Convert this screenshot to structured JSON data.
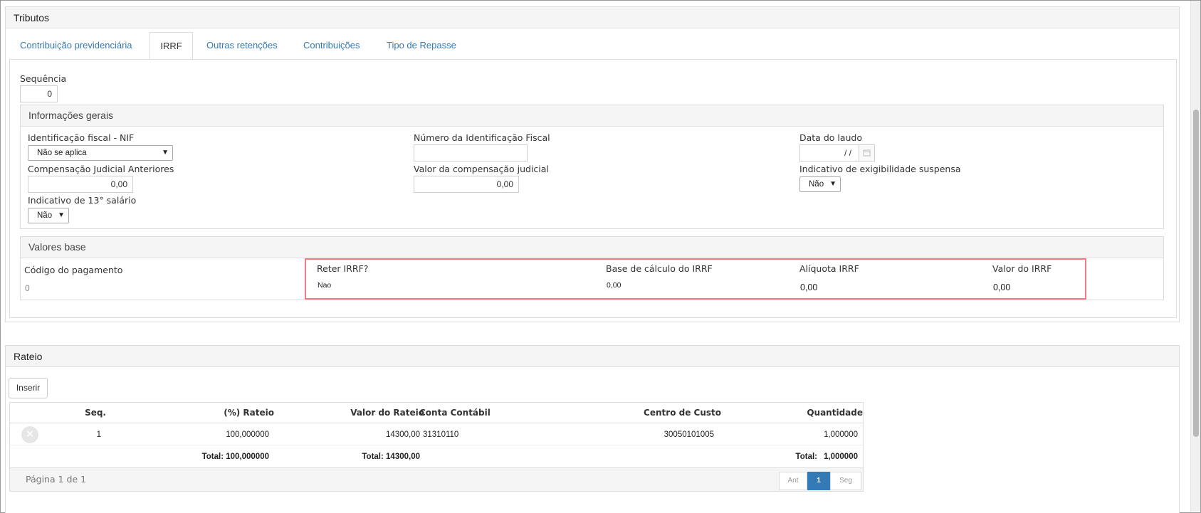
{
  "tributos": {
    "title": "Tributos",
    "tabs": [
      "Contribuição previdenciária",
      "IRRF",
      "Outras retenções",
      "Contribuições",
      "Tipo de Repasse"
    ],
    "active_tab": "IRRF",
    "sequencia": {
      "label": "Sequência",
      "value": "0"
    },
    "informacoes_gerais": {
      "title": "Informações gerais",
      "nif_label": "Identificação fiscal - NIF",
      "nif_value": "Não se aplica",
      "numero_nif_label": "Número da Identificação Fiscal",
      "numero_nif_value": "",
      "data_laudo_label": "Data do laudo",
      "data_laudo_value": "/ /",
      "compensacao_label": "Compensação Judicial Anteriores",
      "compensacao_value": "0,00",
      "valor_compensacao_label": "Valor da compensação judicial",
      "valor_compensacao_value": "0,00",
      "exigibilidade_label": "Indicativo de exigibilidade suspensa",
      "exigibilidade_value": "Não",
      "decimo_label": "Indicativo de 13° salário",
      "decimo_value": "Não"
    },
    "valores_base": {
      "title": "Valores base",
      "codigo_label": "Código do pagamento",
      "codigo_value": "0",
      "reter_label": "Reter IRRF?",
      "reter_value": "Nao",
      "base_label": "Base de cálculo do IRRF",
      "base_value": "0,00",
      "aliquota_label": "Alíquota IRRF",
      "aliquota_value": "0,00",
      "valor_label": "Valor do IRRF",
      "valor_value": "0,00"
    }
  },
  "rateio": {
    "title": "Rateio",
    "insert_label": "Inserir",
    "columns": [
      "Seq.",
      "(%) Rateio",
      "Valor do Rateio",
      "Conta Contábil",
      "Centro de Custo",
      "Quantidade"
    ],
    "rows": [
      {
        "seq": "1",
        "rateio": "100,000000",
        "valor": "14300,00",
        "conta": "31310110",
        "centro": "30050101005",
        "quantidade": "1,000000"
      }
    ],
    "totals": {
      "rateio": "Total: 100,000000",
      "valor": "Total: 14300,00",
      "quantidade_label": "Total:",
      "quantidade": "1,000000"
    },
    "pagination": {
      "text": "Página 1 de 1",
      "prev": "Ant",
      "current": "1",
      "next": "Seg"
    }
  },
  "colors": {
    "link": "#337ab7",
    "highlight": "#f07a85"
  },
  "icons": {
    "calendar": "calendar-icon",
    "delete": "delete-row-icon",
    "dropdown": "chevron-down-icon"
  }
}
